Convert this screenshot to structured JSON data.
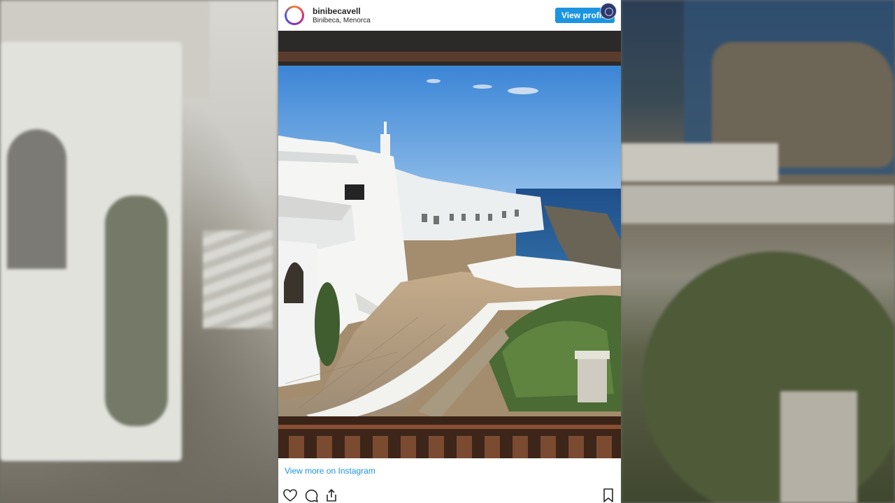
{
  "post": {
    "username": "binibecavell",
    "location": "Binibeca, Menorca",
    "view_profile_label": "View profile",
    "view_more_label": "View more on Instagram"
  },
  "icons": {
    "like": "heart-icon",
    "comment": "comment-icon",
    "share": "share-icon",
    "save": "bookmark-icon"
  },
  "colors": {
    "accent": "#1b95e0",
    "text": "#262626"
  }
}
